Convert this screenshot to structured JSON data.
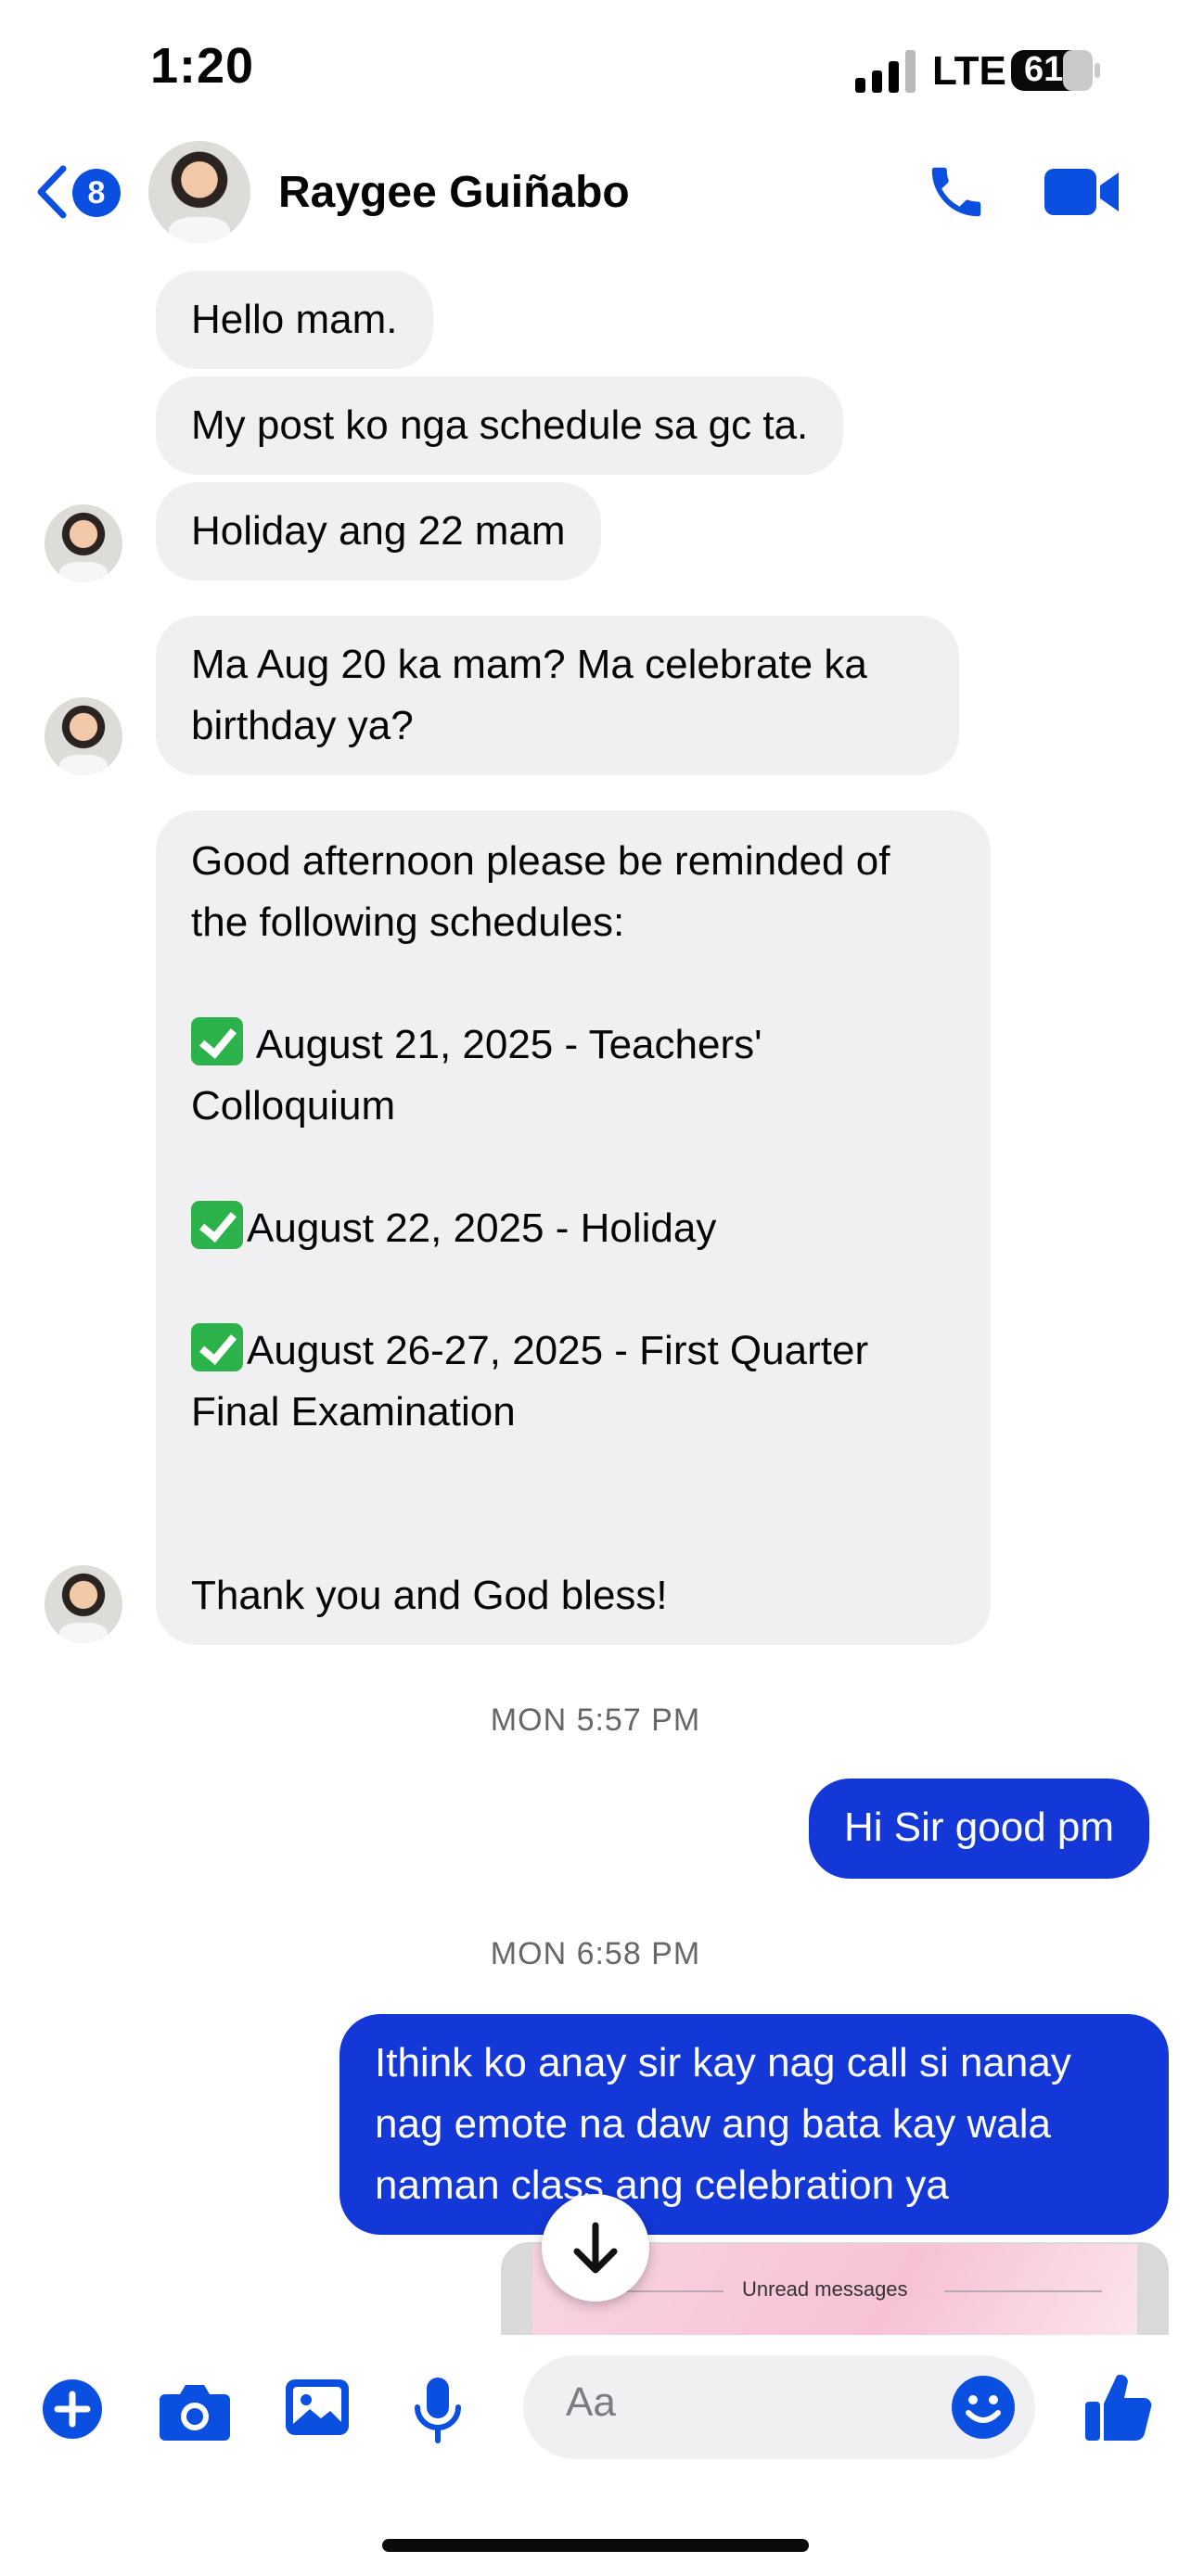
{
  "status_bar": {
    "time": "1:20",
    "network": "LTE",
    "battery": "61"
  },
  "header": {
    "back_count": "8",
    "contact_name": "Raygee Guiñabo"
  },
  "messages": {
    "m1": "Hello mam.",
    "m2": "My post ko nga schedule sa gc ta.",
    "m3": "Holiday ang 22 mam",
    "m4_l1": "Ma Aug 20 ka mam? Ma celebrate ka",
    "m4_l2": "birthday ya?",
    "m5_l1": "Good afternoon please be reminded of",
    "m5_l2": "the following schedules:",
    "m5_l3": " August 21, 2025 - Teachers'",
    "m5_l4": "Colloquium",
    "m5_l5": "August 22, 2025  - Holiday",
    "m5_l6": "August 26-27, 2025 - First Quarter",
    "m5_l7": "Final Examination",
    "m5_l8": "Thank you and God bless!",
    "stamp1": "MON 5:57 PM",
    "me1": "Hi Sir good pm",
    "stamp2": "MON 6:58 PM",
    "me2_l1": "Ithink ko anay sir kay nag call si nanay",
    "me2_l2": "nag emote na daw ang bata kay wala",
    "me2_l3": "naman class ang celebration ya"
  },
  "preview": {
    "label": "Unread messages"
  },
  "composer": {
    "placeholder": "Aa"
  },
  "colors": {
    "accent": "#1437d8",
    "icon": "#0a4fe0",
    "bubble_incoming": "#f0f0f2"
  },
  "icons": [
    "chevron-left-icon",
    "phone-icon",
    "video-camera-icon",
    "plus-icon",
    "camera-icon",
    "image-icon",
    "microphone-icon",
    "smile-icon",
    "thumbs-up-icon",
    "arrow-down-icon",
    "check-icon"
  ]
}
